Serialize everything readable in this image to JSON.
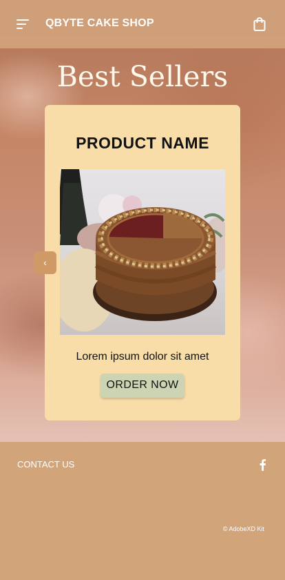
{
  "header": {
    "brand": "QBYTE CAKE SHOP",
    "menu_icon": "hamburger-menu-icon",
    "cart_icon": "shopping-bag-icon"
  },
  "hero": {
    "title": "Best Sellers"
  },
  "product_card": {
    "name": "PRODUCT NAME",
    "image": "chocolate-red-velvet-cake-photo",
    "description": "Lorem ipsum dolor sit amet",
    "order_label": "ORDER NOW",
    "prev_label": "‹"
  },
  "footer": {
    "contact_label": "CONTACT US",
    "social_icon": "facebook-icon",
    "copyright": "© AdobeXD Kit"
  },
  "colors": {
    "header_bg": "#d6aa82",
    "card_bg": "#f8dda8",
    "order_button_bg": "#cdd4b3",
    "prev_button_bg": "#cf9a66",
    "footer_bg": "#d2a47a",
    "title_color": "#fff8ec"
  }
}
